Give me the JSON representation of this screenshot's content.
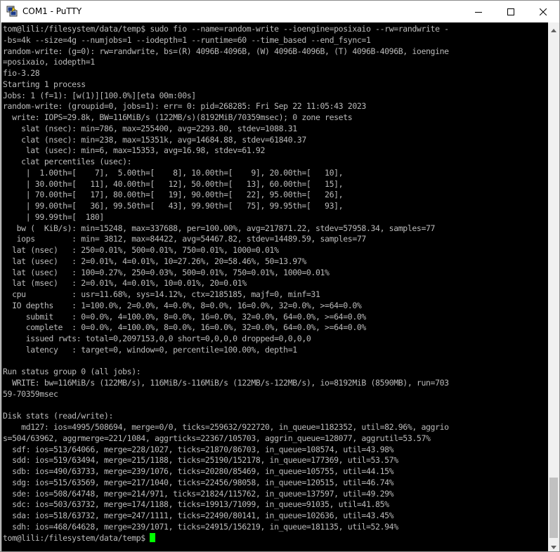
{
  "window": {
    "title": "COM1 - PuTTY",
    "icon": "putty-icon",
    "controls": [
      "minimize-icon",
      "maximize-icon",
      "close-icon"
    ]
  },
  "colors": {
    "terminal_bg": "#000000",
    "terminal_fg": "#bbbbbb",
    "cursor": "#00ff00"
  },
  "terminal": {
    "lines": [
      "tom@lili:/filesystem/data/temp$ sudo fio --name=random-write --ioengine=posixaio --rw=randwrite -",
      "-bs=4k --size=4g --numjobs=1 --iodepth=1 --runtime=60 --time_based --end_fsync=1",
      "random-write: (g=0): rw=randwrite, bs=(R) 4096B-4096B, (W) 4096B-4096B, (T) 4096B-4096B, ioengine",
      "=posixaio, iodepth=1",
      "fio-3.28",
      "Starting 1 process",
      "Jobs: 1 (f=1): [w(1)][100.0%][eta 00m:00s]",
      "random-write: (groupid=0, jobs=1): err= 0: pid=268285: Fri Sep 22 11:05:43 2023",
      "  write: IOPS=29.8k, BW=116MiB/s (122MB/s)(8192MiB/70359msec); 0 zone resets",
      "    slat (nsec): min=786, max=255400, avg=2293.80, stdev=1088.31",
      "    clat (nsec): min=238, max=15351k, avg=14684.88, stdev=61840.37",
      "     lat (usec): min=6, max=15353, avg=16.98, stdev=61.92",
      "    clat percentiles (usec):",
      "     |  1.00th=[    7],  5.00th=[    8], 10.00th=[    9], 20.00th=[   10],",
      "     | 30.00th=[   11], 40.00th=[   12], 50.00th=[   13], 60.00th=[   15],",
      "     | 70.00th=[   17], 80.00th=[   19], 90.00th=[   22], 95.00th=[   26],",
      "     | 99.00th=[   36], 99.50th=[   43], 99.90th=[   75], 99.95th=[   93],",
      "     | 99.99th=[  180]",
      "   bw (  KiB/s): min=15248, max=337688, per=100.00%, avg=217871.22, stdev=57958.34, samples=77",
      "   iops        : min= 3812, max=84422, avg=54467.82, stdev=14489.59, samples=77",
      "  lat (nsec)   : 250=0.01%, 500=0.01%, 750=0.01%, 1000=0.01%",
      "  lat (usec)   : 2=0.01%, 4=0.01%, 10=27.26%, 20=58.46%, 50=13.97%",
      "  lat (usec)   : 100=0.27%, 250=0.03%, 500=0.01%, 750=0.01%, 1000=0.01%",
      "  lat (msec)   : 2=0.01%, 4=0.01%, 10=0.01%, 20=0.01%",
      "  cpu          : usr=11.68%, sys=14.12%, ctx=2185185, majf=0, minf=31",
      "  IO depths    : 1=100.0%, 2=0.0%, 4=0.0%, 8=0.0%, 16=0.0%, 32=0.0%, >=64=0.0%",
      "     submit    : 0=0.0%, 4=100.0%, 8=0.0%, 16=0.0%, 32=0.0%, 64=0.0%, >=64=0.0%",
      "     complete  : 0=0.0%, 4=100.0%, 8=0.0%, 16=0.0%, 32=0.0%, 64=0.0%, >=64=0.0%",
      "     issued rwts: total=0,2097153,0,0 short=0,0,0,0 dropped=0,0,0,0",
      "     latency   : target=0, window=0, percentile=100.00%, depth=1",
      "",
      "Run status group 0 (all jobs):",
      "  WRITE: bw=116MiB/s (122MB/s), 116MiB/s-116MiB/s (122MB/s-122MB/s), io=8192MiB (8590MB), run=703",
      "59-70359msec",
      "",
      "Disk stats (read/write):",
      "    md127: ios=4995/508694, merge=0/0, ticks=259632/922720, in_queue=1182352, util=82.96%, aggrio",
      "s=504/63962, aggrmerge=221/1084, aggrticks=22367/105703, aggrin_queue=128077, aggrutil=53.57%",
      "  sdf: ios=513/64066, merge=228/1027, ticks=21870/86703, in_queue=108574, util=43.98%",
      "  sdd: ios=519/63494, merge=215/1188, ticks=25190/152178, in_queue=177369, util=53.57%",
      "  sdb: ios=490/63733, merge=239/1076, ticks=20280/85469, in_queue=105755, util=44.15%",
      "  sdg: ios=515/63569, merge=217/1040, ticks=22456/98058, in_queue=120515, util=46.74%",
      "  sde: ios=508/64748, merge=214/971, ticks=21824/115762, in_queue=137597, util=49.29%",
      "  sdc: ios=503/63732, merge=174/1188, ticks=19913/71099, in_queue=91035, util=41.85%",
      "  sda: ios=518/63732, merge=247/1111, ticks=22490/80141, in_queue=102636, util=43.45%",
      "  sdh: ios=468/64628, merge=239/1071, ticks=24915/156219, in_queue=181135, util=52.94%"
    ],
    "prompt": "tom@lili:/filesystem/data/temp$"
  }
}
